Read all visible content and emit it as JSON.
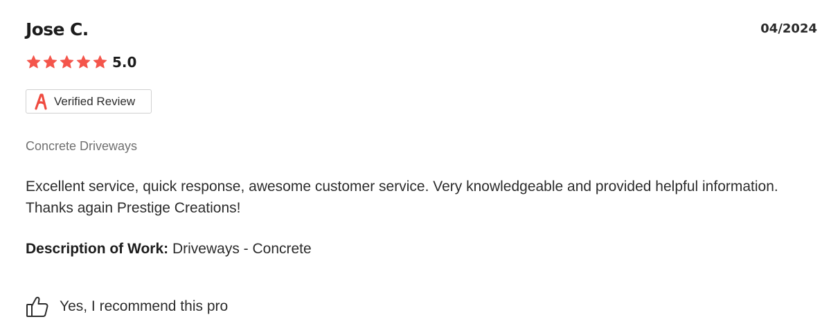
{
  "review": {
    "reviewer_name": "Jose C.",
    "date": "04/2024",
    "rating": {
      "value": 5,
      "max": 5,
      "label": "5.0",
      "star_icon": "star-icon",
      "star_color": "#f4554b"
    },
    "verified_badge": {
      "label": "Verified Review",
      "icon": "angi-logo-icon",
      "icon_color": "#ef4a3f"
    },
    "service_category": "Concrete Driveways",
    "body": "Excellent service, quick response, awesome customer service. Very knowledgeable and provided helpful information. Thanks again Prestige Creations!",
    "work_description": {
      "label": "Description of Work:",
      "value": "Driveways - Concrete"
    },
    "recommendation": {
      "icon": "thumbs-up-icon",
      "label": "Yes, I recommend this pro"
    }
  }
}
